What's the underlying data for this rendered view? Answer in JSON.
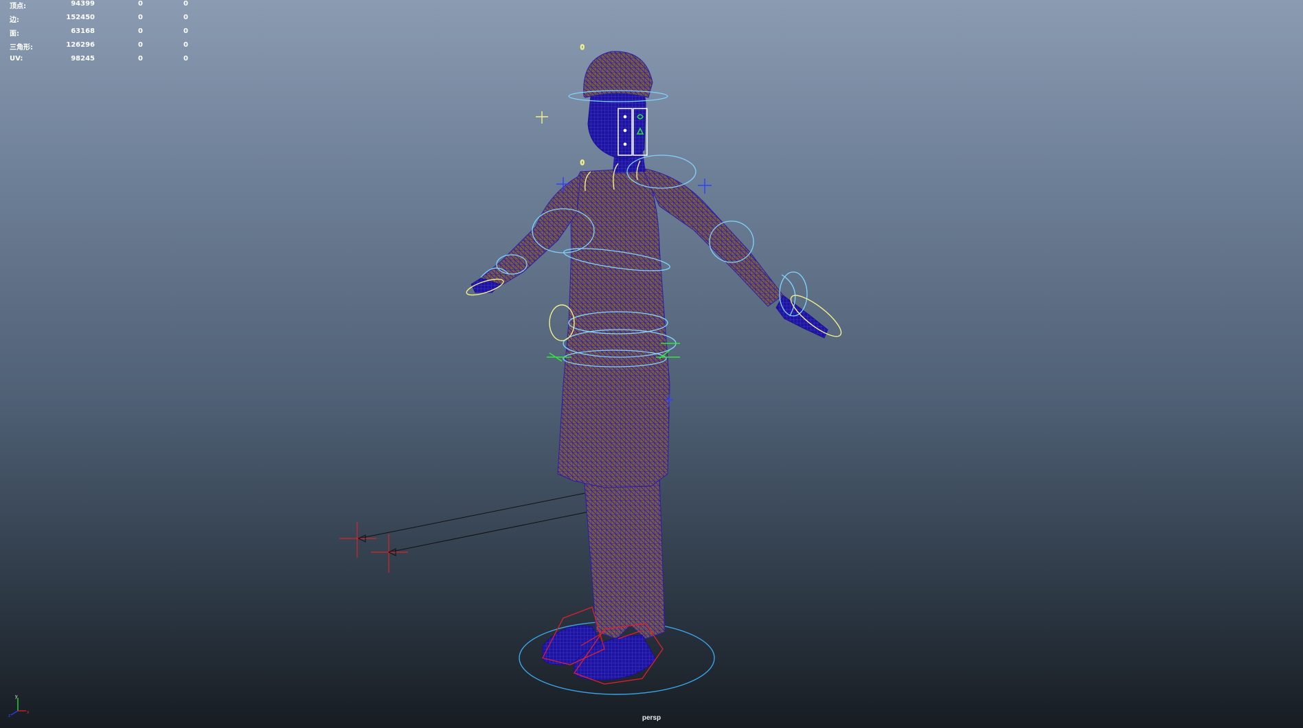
{
  "hud": {
    "rows": [
      {
        "label": "顶点:",
        "total": "94399",
        "selected": "0",
        "component": "0"
      },
      {
        "label": "边:",
        "total": "152450",
        "selected": "0",
        "component": "0"
      },
      {
        "label": "面:",
        "total": "63168",
        "selected": "0",
        "component": "0"
      },
      {
        "label": "三角形:",
        "total": "126296",
        "selected": "0",
        "component": "0"
      },
      {
        "label": "UV:",
        "total": "98245",
        "selected": "0",
        "component": "0"
      }
    ]
  },
  "viewport": {
    "camera": "persp",
    "axes": {
      "x": "x",
      "y": "y",
      "z": "z"
    },
    "colors": {
      "mesh_wire": "#3a2ab8",
      "mesh_fill": "#7a5a44",
      "control_cyan": "#7fd4ff",
      "control_yellow": "#f4f08a",
      "control_green": "#2ee83a",
      "control_red": "#e0202a",
      "locator_blue": "#3040ff"
    }
  }
}
